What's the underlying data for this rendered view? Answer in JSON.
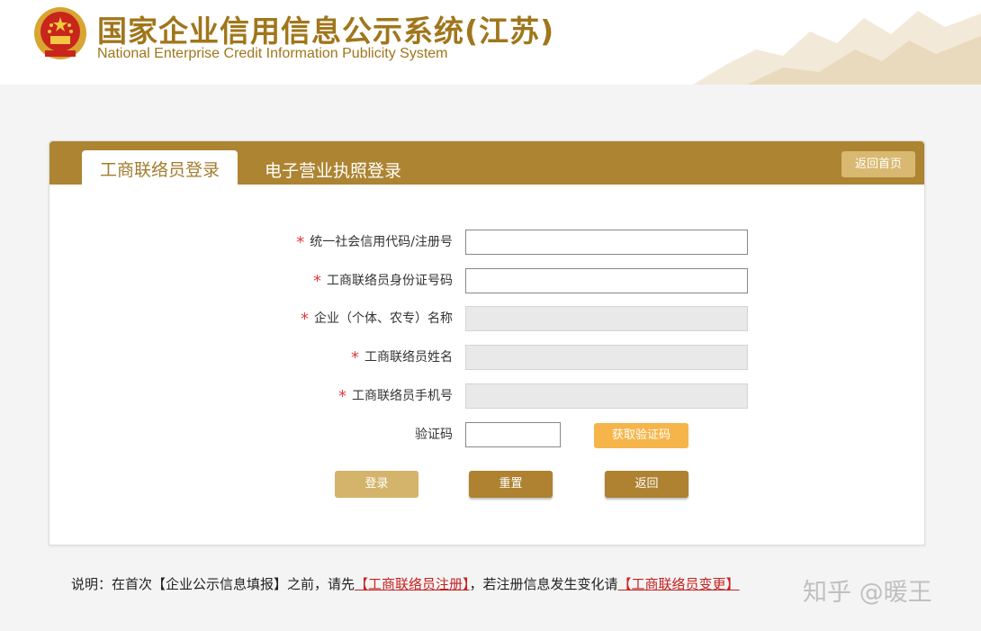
{
  "header": {
    "title_cn": "国家企业信用信息公示系统(江苏)",
    "title_en": "National Enterprise Credit Information Publicity System"
  },
  "tabs": {
    "active": "工商联络员登录",
    "inactive": "电子营业执照登录"
  },
  "home_button": "返回首页",
  "form": {
    "credit_code_label": "统一社会信用代码/注册号",
    "id_number_label": "工商联络员身份证号码",
    "enterprise_name_label": "企业（个体、农专）名称",
    "liaison_name_label": "工商联络员姓名",
    "liaison_phone_label": "工商联络员手机号",
    "captcha_label": "验证码",
    "get_code_button": "获取验证码",
    "required_mark": "*"
  },
  "buttons": {
    "login": "登录",
    "reset": "重置",
    "back": "返回"
  },
  "note": {
    "prefix": "说明：在首次【企业公示信息填报】之前，请先",
    "register_link": "【工商联络员注册】",
    "middle": "，若注册信息发生变化请",
    "change_link": "【工商联络员变更】"
  },
  "watermark": "知乎 @暖王",
  "colors": {
    "brand_gold": "#ad8431",
    "light_gold": "#d4b36a",
    "orange": "#f6b54a",
    "required_red": "#e43c3c",
    "link_red": "#c62121"
  }
}
